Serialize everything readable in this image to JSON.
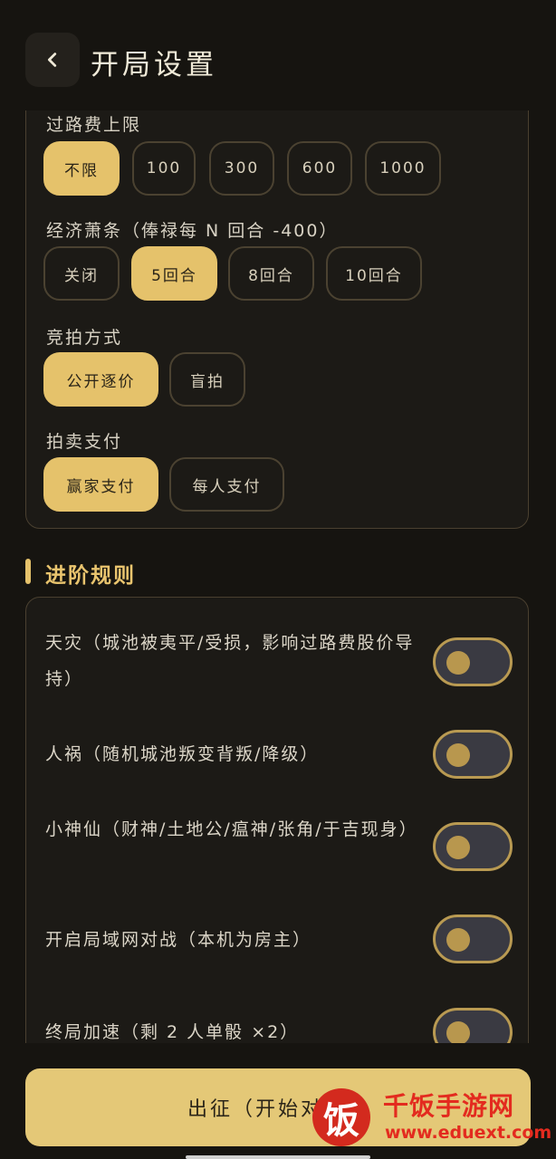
{
  "header": {
    "title": "开局设置"
  },
  "settings": {
    "toll_limit": {
      "label": "过路费上限",
      "options": [
        "不限",
        "100",
        "300",
        "600",
        "1000"
      ],
      "selected": "不限"
    },
    "recession": {
      "label": "经济萧条（俸禄每 N 回合 -400）",
      "options": [
        "关闭",
        "5回合",
        "8回合",
        "10回合"
      ],
      "selected": "5回合"
    },
    "bidding": {
      "label": "竞拍方式",
      "options": [
        "公开逐价",
        "盲拍"
      ],
      "selected": "公开逐价"
    },
    "payment": {
      "label": "拍卖支付",
      "options": [
        "赢家支付",
        "每人支付"
      ],
      "selected": "赢家支付"
    }
  },
  "advanced": {
    "title": "进阶规则",
    "rules": [
      {
        "text": "天灾（城池被夷平/受损，影响过路费股价导持）",
        "enabled": false
      },
      {
        "text": "人祸（随机城池叛变背叛/降级）",
        "enabled": false
      },
      {
        "text": "小神仙（财神/土地公/瘟神/张角/于吉现身）",
        "enabled": false
      },
      {
        "text": "开启局域网对战（本机为房主）",
        "enabled": false
      },
      {
        "text": "终局加速（剩 2 人单骰 ×2）",
        "enabled": false
      }
    ]
  },
  "footer": {
    "start_label": "出征（开始对局）"
  },
  "watermark": {
    "logo": "饭",
    "name": "千饭手游网",
    "url": "www.eduext.com"
  },
  "colors": {
    "accent": "#e5c26b",
    "background": "#161410",
    "card": "#1c1a16",
    "border": "#4a4030"
  }
}
